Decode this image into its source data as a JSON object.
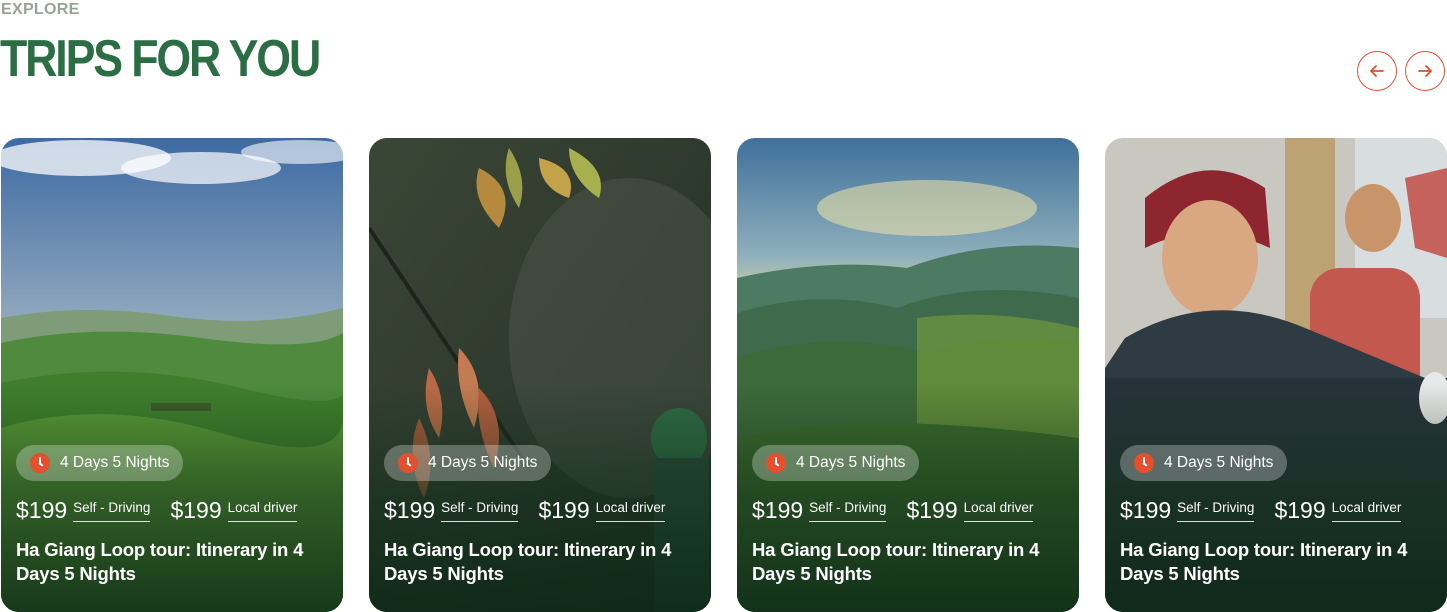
{
  "header": {
    "eyebrow": "EXPLORE",
    "title": "TRIPS FOR YOU"
  },
  "nav": {
    "prev_icon": "arrow-left-icon",
    "next_icon": "arrow-right-icon"
  },
  "colors": {
    "brand_green": "#2c6e43",
    "accent": "#e0522e",
    "eyebrow_gray": "#9aa29c"
  },
  "cards": [
    {
      "image": "rolling-green-hills",
      "duration": "4 Days 5 Nights",
      "price_self": "$199",
      "label_self": "Self - Driving",
      "price_driver": "$199",
      "label_driver": "Local driver",
      "title": "Ha Giang Loop tour: Itinerary in 4 Days 5 Nights"
    },
    {
      "image": "leaves-and-person",
      "duration": "4 Days 5 Nights",
      "price_self": "$199",
      "label_self": "Self - Driving",
      "price_driver": "$199",
      "label_driver": "Local driver",
      "title": "Ha Giang Loop tour: Itinerary in 4 Days 5 Nights"
    },
    {
      "image": "mountain-rice-terraces",
      "duration": "4 Days 5 Nights",
      "price_self": "$199",
      "label_self": "Self - Driving",
      "price_driver": "$199",
      "label_driver": "Local driver",
      "title": "Ha Giang Loop tour: Itinerary in 4 Days 5 Nights"
    },
    {
      "image": "local-woman-portrait",
      "duration": "4 Days 5 Nights",
      "price_self": "$199",
      "label_self": "Self - Driving",
      "price_driver": "$199",
      "label_driver": "Local driver",
      "title": "Ha Giang Loop tour: Itinerary in 4 Days 5 Nights"
    }
  ]
}
